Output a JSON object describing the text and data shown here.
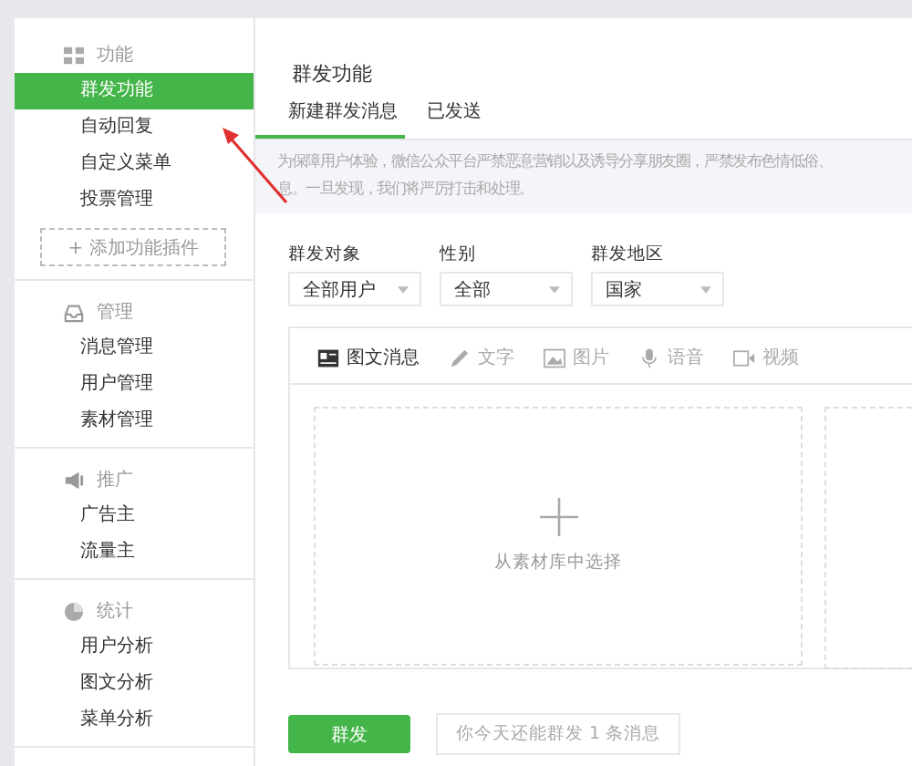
{
  "sidebar": {
    "sections": [
      {
        "title": "功能",
        "items": [
          {
            "label": "群发功能",
            "selected": true
          },
          {
            "label": "自动回复",
            "selected": false
          },
          {
            "label": "自定义菜单",
            "selected": false
          },
          {
            "label": "投票管理",
            "selected": false
          }
        ],
        "add_button": "+ 添加功能插件"
      },
      {
        "title": "管理",
        "items": [
          {
            "label": "消息管理",
            "selected": false
          },
          {
            "label": "用户管理",
            "selected": false
          },
          {
            "label": "素材管理",
            "selected": false
          }
        ]
      },
      {
        "title": "推广",
        "items": [
          {
            "label": "广告主",
            "selected": false
          },
          {
            "label": "流量主",
            "selected": false
          }
        ]
      },
      {
        "title": "统计",
        "items": [
          {
            "label": "用户分析",
            "selected": false
          },
          {
            "label": "图文分析",
            "selected": false
          },
          {
            "label": "菜单分析",
            "selected": false
          }
        ]
      }
    ]
  },
  "main": {
    "title": "群发功能",
    "tabs": [
      {
        "label": "新建群发消息",
        "selected": true
      },
      {
        "label": "已发送",
        "selected": false
      }
    ],
    "notice": [
      "为保障用户体验，微信公众平台严禁恶意营销以及诱导分享朋友圈，严禁发布色情低俗、",
      "息。一旦发现，我们将严厉打击和处理。"
    ],
    "filters": [
      {
        "label": "群发对象",
        "value": "全部用户"
      },
      {
        "label": "性别",
        "value": "全部"
      },
      {
        "label": "群发地区",
        "value": "国家"
      }
    ],
    "editor_tabs": [
      {
        "label": "图文消息",
        "selected": true
      },
      {
        "label": "文字",
        "selected": false
      },
      {
        "label": "图片",
        "selected": false
      },
      {
        "label": "语音",
        "selected": false
      },
      {
        "label": "视频",
        "selected": false
      }
    ],
    "picker_label": "从素材库中选择",
    "send_button": "群发",
    "quota_hint": "你今天还能群发 1 条消息"
  }
}
